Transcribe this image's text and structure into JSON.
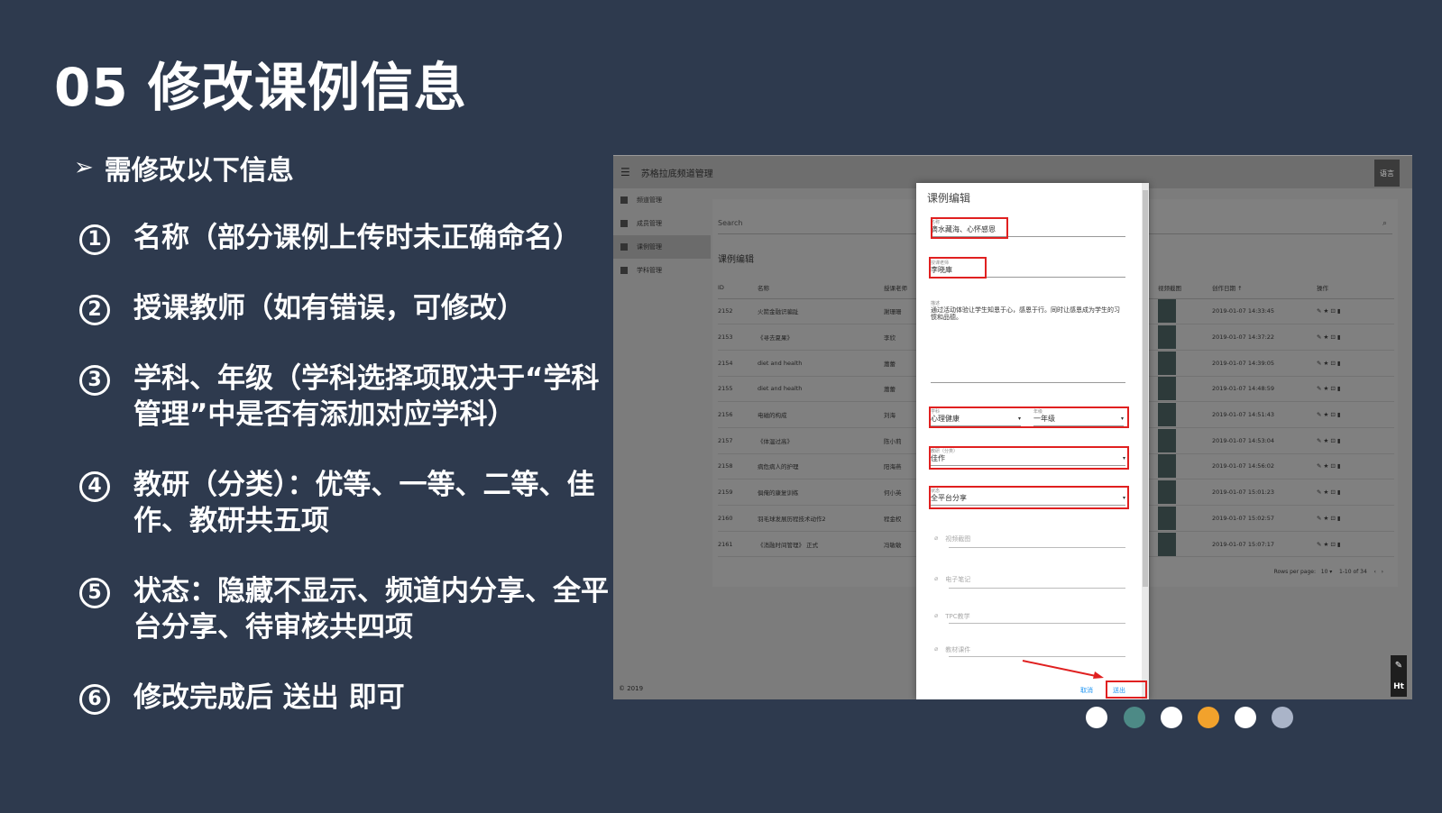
{
  "slide": {
    "title": "05 修改课例信息",
    "intro_arrow": "➢",
    "intro": "需修改以下信息",
    "items": [
      {
        "num": "1",
        "text": "名称（部分课例上传时未正确命名）"
      },
      {
        "num": "2",
        "text": "授课教师（如有错误，可修改）"
      },
      {
        "num": "3",
        "text": "学科、年级（学科选择项取决于“学科管理”中是否有添加对应学科）"
      },
      {
        "num": "4",
        "text": "教研（分类）：优等、一等、二等、佳作、教研共五项"
      },
      {
        "num": "5",
        "text": "状态：隐藏不显示、频道内分享、全平台分享、待审核共四项"
      },
      {
        "num": "6",
        "text": "修改完成后 送出 即可"
      }
    ]
  },
  "app": {
    "menu_icon": "☰",
    "title": "苏格拉底频道管理",
    "lang": "语言",
    "sidebar": [
      "频道管理",
      "成员管理",
      "课例管理",
      "学科管理"
    ],
    "search_placeholder": "Search",
    "section": "课例编辑",
    "columns": [
      "ID",
      "名称",
      "授课老师",
      "视频截图",
      "创作日期 ↑",
      "操作"
    ],
    "rows": [
      {
        "id": "2152",
        "name": "火箭金融识骗趾",
        "teacher": "謝珊珊",
        "date": "2019-01-07 14:33:45"
      },
      {
        "id": "2153",
        "name": "《寻去夏果》",
        "teacher": "李欣",
        "date": "2019-01-07 14:37:22"
      },
      {
        "id": "2154",
        "name": "diet and health",
        "teacher": "蕭蕾",
        "date": "2019-01-07 14:39:05"
      },
      {
        "id": "2155",
        "name": "diet and health",
        "teacher": "蕭蕾",
        "date": "2019-01-07 14:48:59"
      },
      {
        "id": "2156",
        "name": "电磁的构成",
        "teacher": "刘海",
        "date": "2019-01-07 14:51:43"
      },
      {
        "id": "2157",
        "name": "《体温过高》",
        "teacher": "陈小莉",
        "date": "2019-01-07 14:53:04"
      },
      {
        "id": "2158",
        "name": "病危病人的护理",
        "teacher": "阳海燕",
        "date": "2019-01-07 14:56:02"
      },
      {
        "id": "2159",
        "name": "俱俺的康复训练",
        "teacher": "何小英",
        "date": "2019-01-07 15:01:23"
      },
      {
        "id": "2160",
        "name": "羽毛球发展历程技术动作2",
        "teacher": "程金权",
        "date": "2019-01-07 15:02:57"
      },
      {
        "id": "2161",
        "name": "《消融时间管理》 正式",
        "teacher": "冯敏敏",
        "date": "2019-01-07 15:07:17"
      }
    ],
    "actions": "✎ ★ ⊡ ▮",
    "rows_per_page_label": "Rows per page:",
    "rows_per_page": "10",
    "range": "1-10 of 34",
    "footer": "© 2019"
  },
  "dialog": {
    "title": "课例编辑",
    "name_label": "名称",
    "name_value": "滴水藏海、心怀感恩",
    "teacher_label": "授课老师",
    "teacher_value": "李晓庫",
    "desc_label": "描述",
    "desc_value": "通过活动体验让学生知恩于心，感恩于行。同时让感恩成为学生的习惯和品德。",
    "subject_label": "学科",
    "subject_value": "心理健康",
    "grade_label": "年级",
    "grade_value": "一年级",
    "research_label": "教研（分类）",
    "research_value": "佳作",
    "status_label": "状态",
    "status_value": "全平台分享",
    "uploads": [
      "视频截图",
      "电子笔记",
      "TPC教学",
      "教材课件"
    ],
    "cancel": "取消",
    "submit": "送出"
  },
  "colors": {
    "background": "#2e3a4e",
    "highlight": "#e02020",
    "dots": [
      "#ffffff",
      "#4d8a86",
      "#ffffff",
      "#f2a22c",
      "#ffffff",
      "#aab4c8"
    ]
  }
}
